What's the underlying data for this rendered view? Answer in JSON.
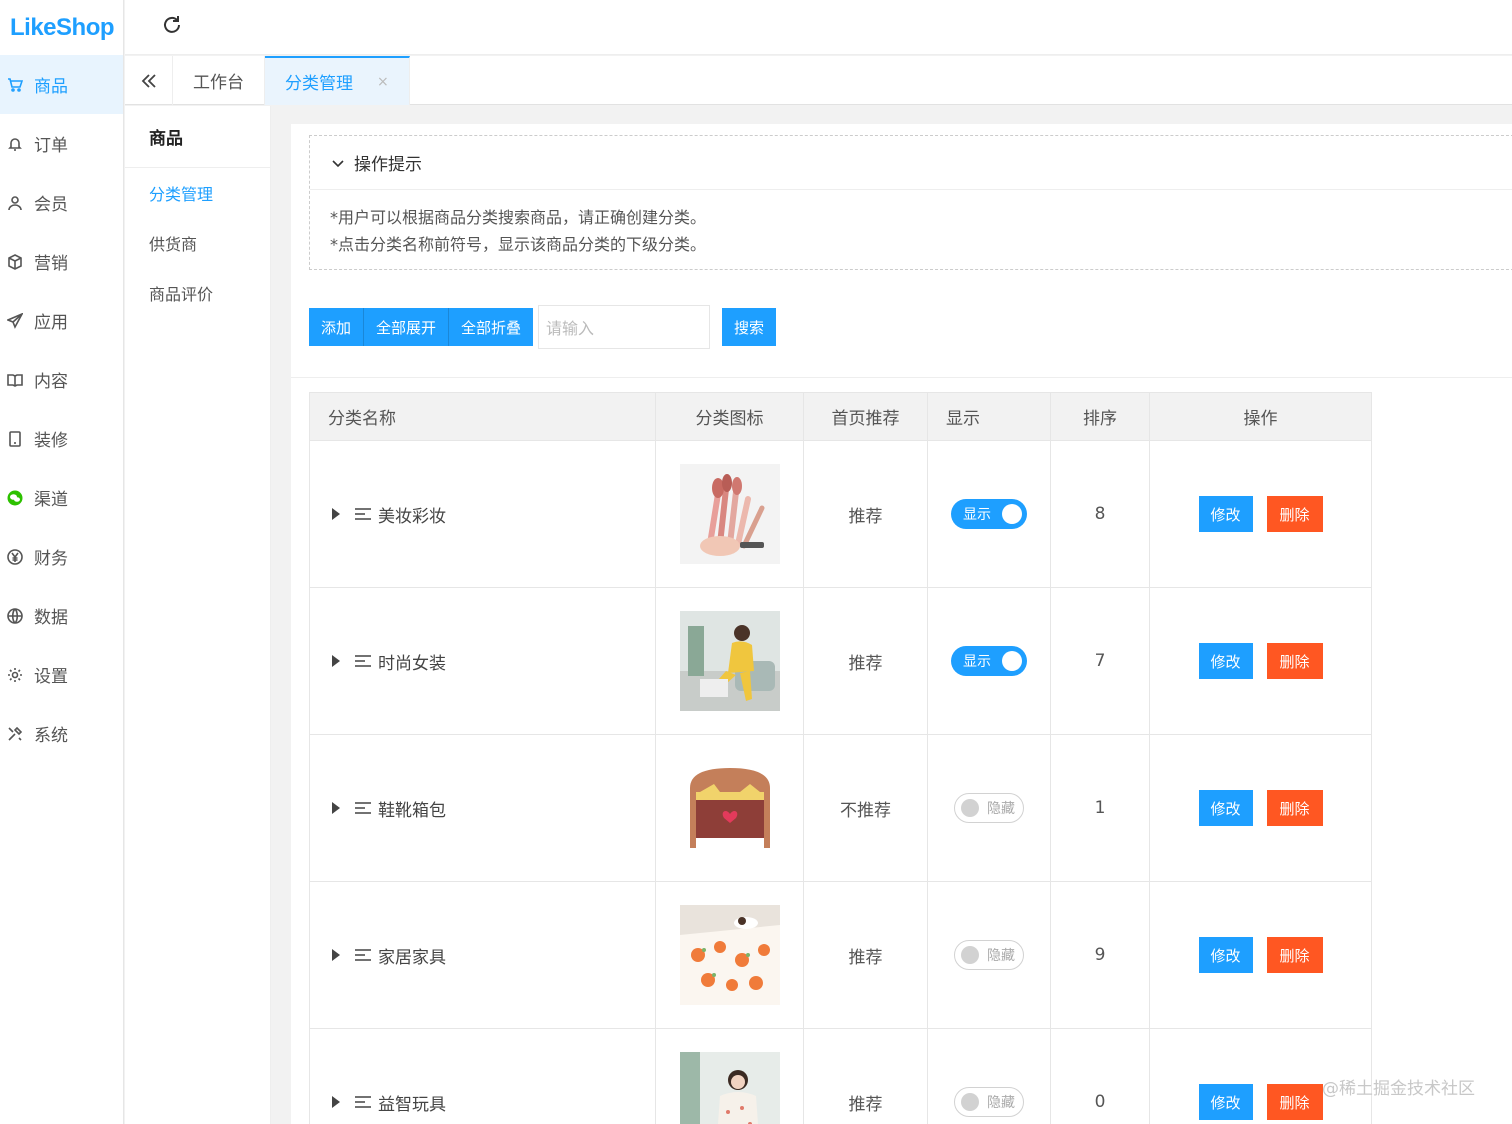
{
  "logo": {
    "part1": "Like",
    "part2": "Shop"
  },
  "rail": [
    {
      "label": "商品",
      "icon": "cart-icon",
      "active": true
    },
    {
      "label": "订单",
      "icon": "bell-icon"
    },
    {
      "label": "会员",
      "icon": "user-icon"
    },
    {
      "label": "营销",
      "icon": "cube-icon"
    },
    {
      "label": "应用",
      "icon": "send-icon"
    },
    {
      "label": "内容",
      "icon": "book-icon"
    },
    {
      "label": "装修",
      "icon": "tablet-icon"
    },
    {
      "label": "渠道",
      "icon": "wechat-icon"
    },
    {
      "label": "财务",
      "icon": "yen-icon"
    },
    {
      "label": "数据",
      "icon": "globe-icon"
    },
    {
      "label": "设置",
      "icon": "gear-icon"
    },
    {
      "label": "系统",
      "icon": "tools-icon"
    }
  ],
  "tabs": [
    {
      "label": "工作台"
    },
    {
      "label": "分类管理",
      "close": "×"
    }
  ],
  "submenu": {
    "title": "商品",
    "items": [
      "分类管理",
      "供货商",
      "商品评价"
    ]
  },
  "tips": {
    "title": "操作提示",
    "line1": "*用户可以根据商品分类搜索商品，请正确创建分类。",
    "line2": "*点击分类名称前符号，显示该商品分类的下级分类。"
  },
  "toolbar": {
    "add": "添加",
    "expand_all": "全部展开",
    "collapse_all": "全部折叠",
    "search_placeholder": "请输入",
    "search": "搜索"
  },
  "table": {
    "headers": [
      "分类名称",
      "分类图标",
      "首页推荐",
      "显示",
      "排序",
      "操作"
    ],
    "rows": [
      {
        "name": "美妆彩妆",
        "recommend": "推荐",
        "show": "显示",
        "on": true,
        "sort": "8"
      },
      {
        "name": "时尚女装",
        "recommend": "推荐",
        "show": "显示",
        "on": true,
        "sort": "7"
      },
      {
        "name": "鞋靴箱包",
        "recommend": "不推荐",
        "show": "隐藏",
        "on": false,
        "sort": "1"
      },
      {
        "name": "家居家具",
        "recommend": "推荐",
        "show": "隐藏",
        "on": false,
        "sort": "9"
      },
      {
        "name": "益智玩具",
        "recommend": "推荐",
        "show": "隐藏",
        "on": false,
        "sort": "0"
      }
    ],
    "edit": "修改",
    "delete": "删除"
  },
  "watermark": "@稀土掘金技术社区",
  "colors": {
    "primary": "#1e9fff",
    "danger": "#ff5722"
  }
}
